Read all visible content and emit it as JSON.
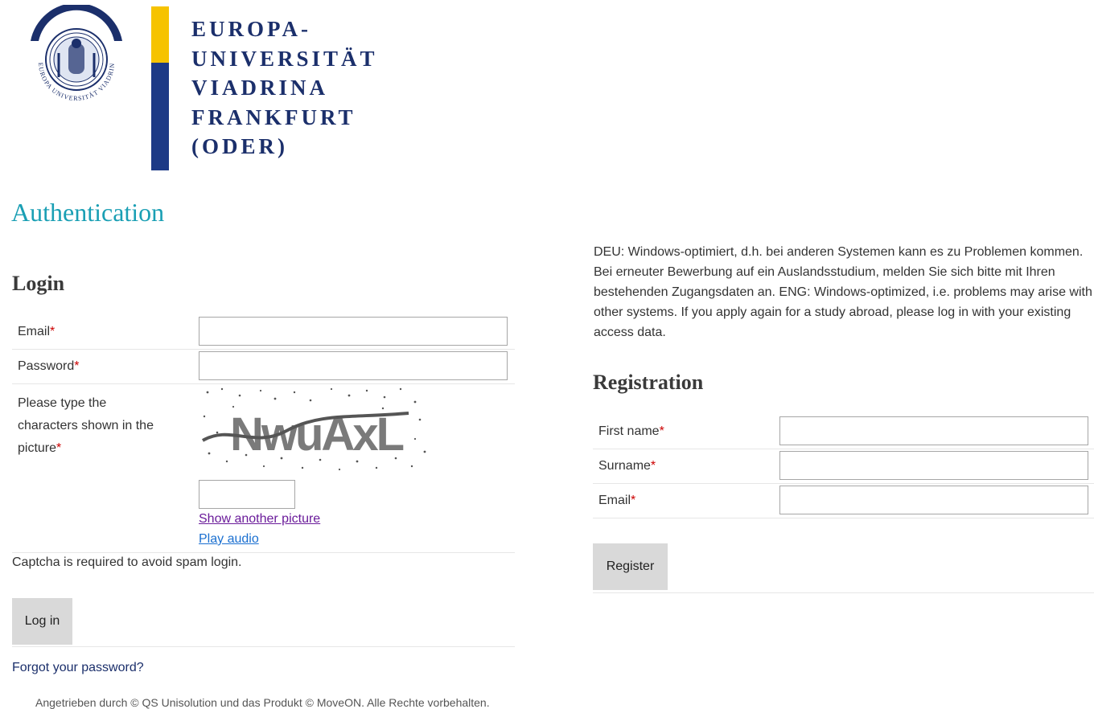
{
  "logo": {
    "seal_text": "EUROPA UNIVERSITÄT VIADRINA",
    "name_lines": [
      "EUROPA-",
      "UNIVERSITÄT",
      "VIADRINA",
      "FRANKFURT",
      "(ODER)"
    ],
    "colors": {
      "navy": "#1b2f6b",
      "yellow": "#f6c300",
      "blue": "#1d3a86"
    }
  },
  "page_title": "Authentication",
  "login": {
    "title": "Login",
    "email_label": "Email",
    "password_label": "Password",
    "captcha_label": "Please type the characters shown in the picture",
    "captcha_image_text": "NwuAxL",
    "show_another": "Show another picture",
    "play_audio": "Play audio",
    "captcha_note": "Captcha is required to avoid spam login.",
    "login_button": "Log in",
    "forgot": "Forgot your password?"
  },
  "info_text": "DEU: Windows-optimiert, d.h. bei anderen Systemen kann es zu Problemen kommen. Bei erneuter Bewerbung auf ein Auslandsstudium, melden Sie sich bitte mit Ihren bestehenden Zugangsdaten an. ENG: Windows-optimized, i.e. problems may arise with other systems. If you apply again for a study abroad, please log in with your existing access data.",
  "registration": {
    "title": "Registration",
    "first_name_label": "First name",
    "surname_label": "Surname",
    "email_label": "Email",
    "register_button": "Register"
  },
  "required_marker": "*",
  "footer": "Angetrieben durch © QS Unisolution und das Produkt © MoveON. Alle Rechte vorbehalten.",
  "colors": {
    "accent": "#1a9fb4",
    "required": "#cc0000",
    "button": "#d9d9d9"
  }
}
